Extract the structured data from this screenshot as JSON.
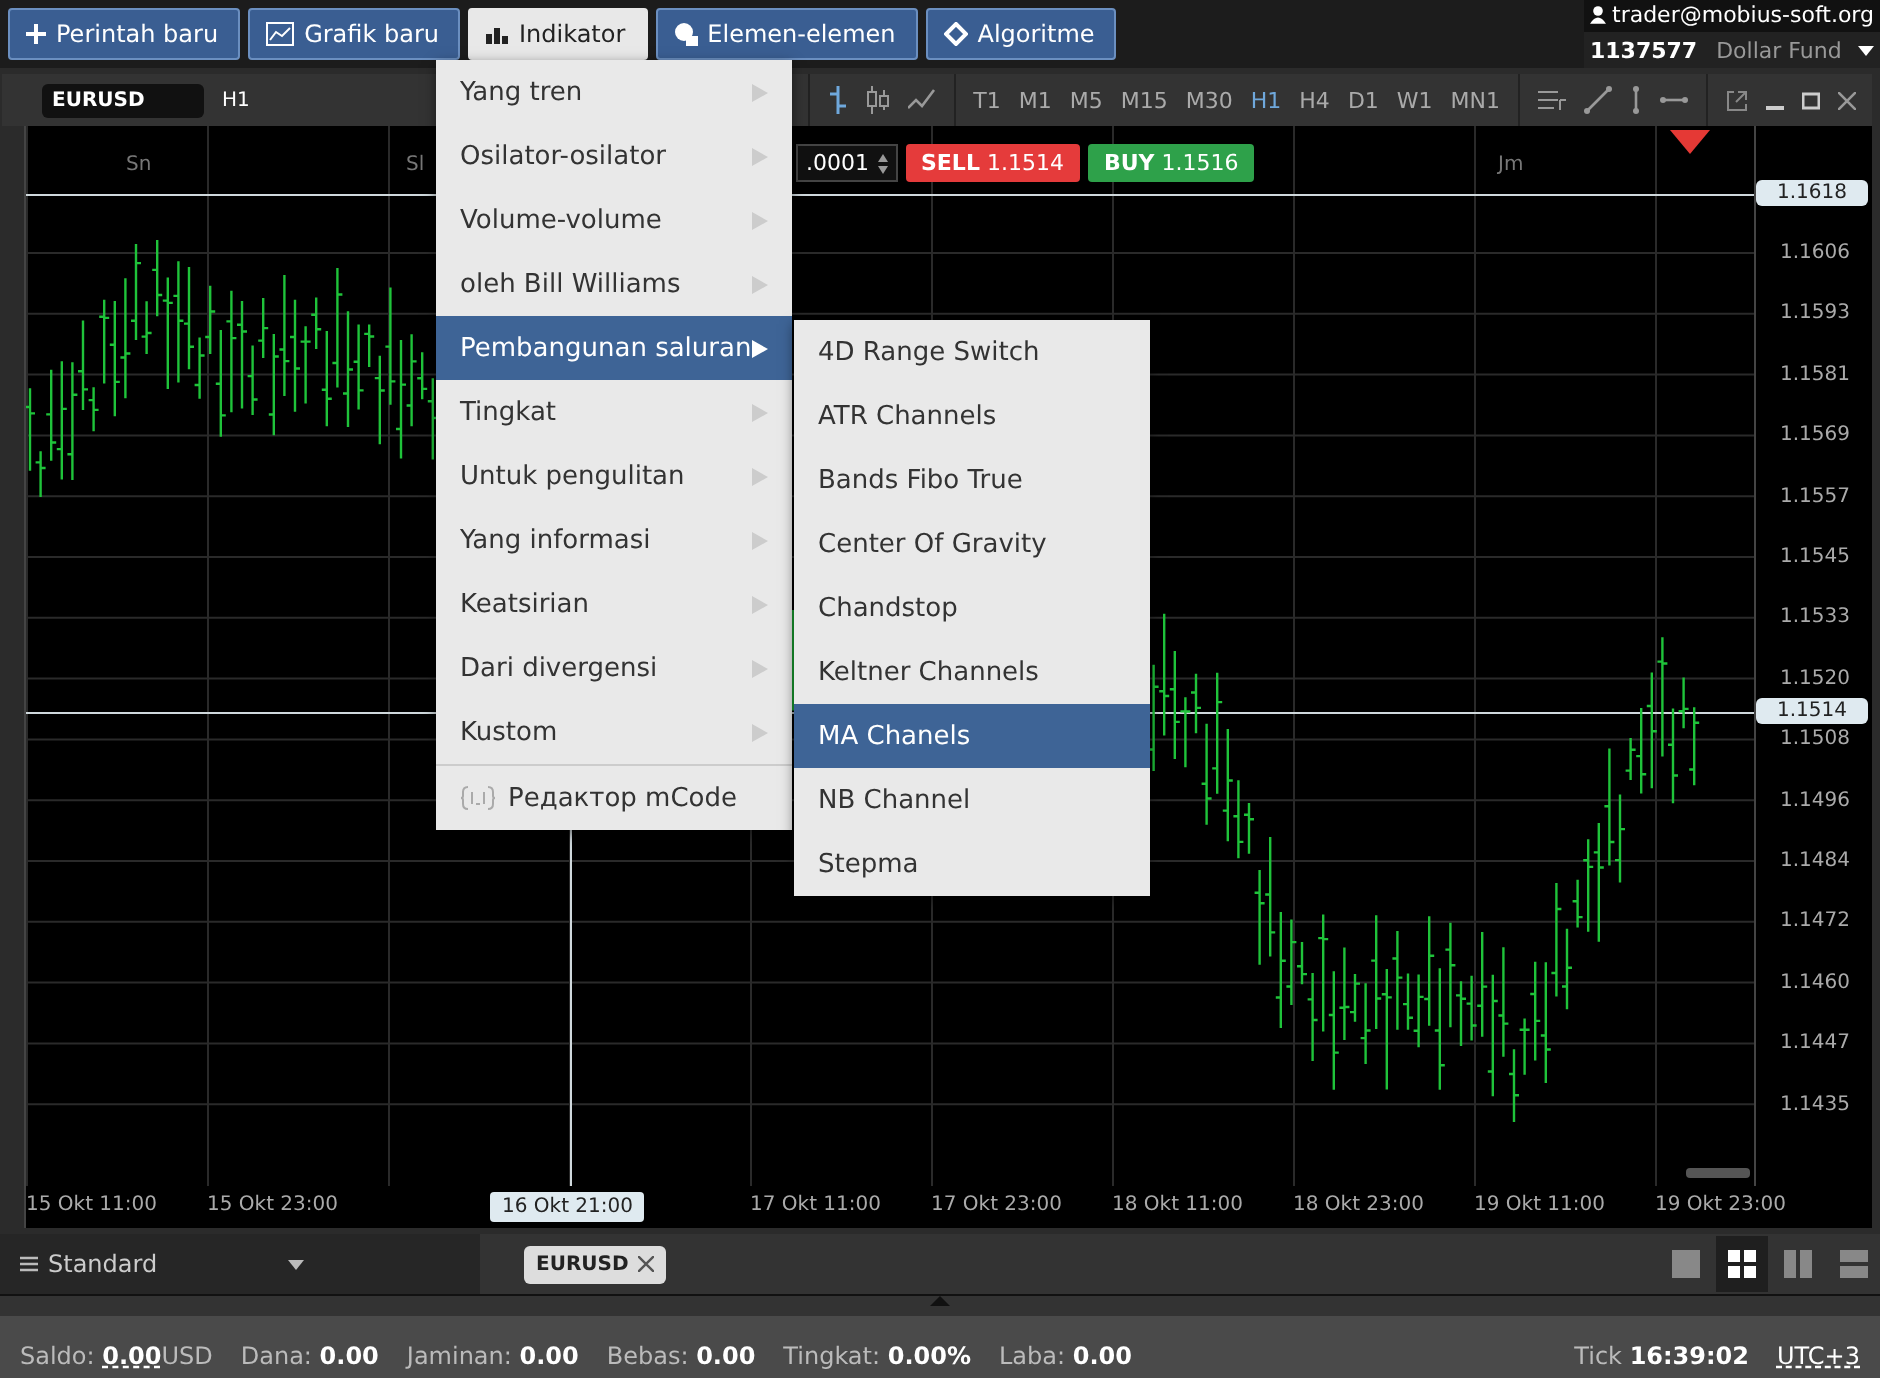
{
  "top_buttons": [
    {
      "label": "Perintah baru",
      "selected": false
    },
    {
      "label": "Grafik baru",
      "selected": false
    },
    {
      "label": "Indikator",
      "selected": true
    },
    {
      "label": "Elemen-elemen",
      "selected": false
    },
    {
      "label": "Algoritme",
      "selected": false
    }
  ],
  "account": {
    "user": "trader@mobius-soft.org",
    "number": "1137577",
    "name": "Dollar Fund"
  },
  "chart_window": {
    "symbol": "EURUSD",
    "period": "H1",
    "lot": ".0001",
    "sell": {
      "label": "SELL",
      "price": "1.1514"
    },
    "buy": {
      "label": "BUY",
      "price": "1.1516"
    },
    "timeframes": [
      {
        "label": "T1",
        "selected": false
      },
      {
        "label": "M1",
        "selected": false
      },
      {
        "label": "M5",
        "selected": false
      },
      {
        "label": "M15",
        "selected": false
      },
      {
        "label": "M30",
        "selected": false
      },
      {
        "label": "H1",
        "selected": true
      },
      {
        "label": "H4",
        "selected": false
      },
      {
        "label": "D1",
        "selected": false
      },
      {
        "label": "W1",
        "selected": false
      },
      {
        "label": "MN1",
        "selected": false
      }
    ],
    "day_labels": [
      "Sn",
      "Sl",
      "Jm"
    ],
    "price_labels": [
      "1.1606",
      "1.1593",
      "1.1581",
      "1.1569",
      "1.1557",
      "1.1545",
      "1.1533",
      "1.1520",
      "1.1508",
      "1.1496",
      "1.1484",
      "1.1472",
      "1.1460",
      "1.1447",
      "1.1435"
    ],
    "price_markers": [
      "1.1618",
      "1.1514"
    ],
    "time_labels": [
      "15 Okt 11:00",
      "15 Okt 23:00",
      "17 Okt 11:00",
      "17 Okt 23:00",
      "18 Okt 11:00",
      "18 Okt 23:00",
      "19 Okt 11:00",
      "19 Okt 23:00"
    ],
    "crosshair_time": "16 Okt 21:00"
  },
  "menu": [
    {
      "label": "Yang tren",
      "kind": "submenu",
      "selected": false
    },
    {
      "label": "Osilator-osilator",
      "kind": "submenu",
      "selected": false
    },
    {
      "label": "Volume-volume",
      "kind": "submenu",
      "selected": false
    },
    {
      "label": "oleh Bill Williams",
      "kind": "submenu",
      "selected": false
    },
    {
      "label": "Pembangunan saluran",
      "kind": "submenu",
      "selected": true
    },
    {
      "label": "Tingkat",
      "kind": "submenu",
      "selected": false
    },
    {
      "label": "Untuk pengulitan",
      "kind": "submenu",
      "selected": false
    },
    {
      "label": "Yang informasi",
      "kind": "submenu",
      "selected": false
    },
    {
      "label": "Keatsirian",
      "kind": "submenu",
      "selected": false
    },
    {
      "label": "Dari divergensi",
      "kind": "submenu",
      "selected": false
    },
    {
      "label": "Kustom",
      "kind": "submenu",
      "selected": false
    },
    {
      "label": "Редактор mCode",
      "kind": "editor",
      "selected": false
    }
  ],
  "submenu": [
    {
      "label": "4D Range Switch",
      "selected": false
    },
    {
      "label": "ATR Channels",
      "selected": false
    },
    {
      "label": "Bands Fibo True",
      "selected": false
    },
    {
      "label": "Center Of Gravity",
      "selected": false
    },
    {
      "label": "Chandstop",
      "selected": false
    },
    {
      "label": "Keltner Channels",
      "selected": false
    },
    {
      "label": "MA Chanels",
      "selected": true
    },
    {
      "label": "NB Channel",
      "selected": false
    },
    {
      "label": "Stepma",
      "selected": false
    }
  ],
  "bottom_bar": {
    "workspace": "Standard",
    "tabs": [
      {
        "label": "EURUSD",
        "selected": true
      }
    ],
    "layouts": [
      {
        "selected": false
      },
      {
        "selected": true
      },
      {
        "selected": false
      },
      {
        "selected": false
      }
    ]
  },
  "status": {
    "items": [
      {
        "label": "Saldo:",
        "value": "0.00",
        "unit": "USD"
      },
      {
        "label": "Dana:",
        "value": "0.00"
      },
      {
        "label": "Jaminan:",
        "value": "0.00"
      },
      {
        "label": "Bebas:",
        "value": "0.00"
      },
      {
        "label": "Tingkat:",
        "value": "0.00%"
      },
      {
        "label": "Laba:",
        "value": "0.00"
      }
    ],
    "tick_label": "Tick",
    "time": "16:39:02",
    "timezone": "UTC+3"
  }
}
